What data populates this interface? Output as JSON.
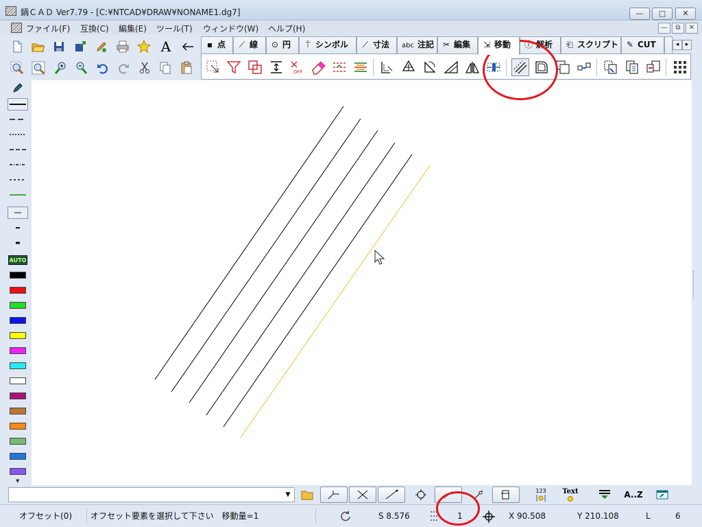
{
  "window": {
    "title": "鍋ＣＡＤ Ver7.79 - [C:¥NTCAD¥DRAW¥NONAME1.dg7]",
    "min_glyph": "—",
    "max_glyph": "□",
    "close_glyph": "✕"
  },
  "menu": {
    "items": [
      "ファイル(F)",
      "互換(C)",
      "編集(E)",
      "ツール(T)",
      "ウィンドウ(W)",
      "ヘルプ(H)"
    ],
    "mdi_buttons": [
      "—",
      "⧉",
      "✕"
    ]
  },
  "toolbar_row1_icons": [
    "new-file-icon",
    "open-folder-icon",
    "save-icon",
    "export-icon",
    "pencil-import-icon",
    "print-icon",
    "star-icon",
    "text-a-icon",
    "arrow-left-icon"
  ],
  "toolbar_row1_glyphs": {
    "text_a": "A",
    "arrow": "⇐"
  },
  "toolbar_row2_icons": [
    "zoom-window-icon",
    "zoom-fit-icon",
    "zoom-in-icon",
    "zoom-out-icon",
    "undo-icon",
    "redo-icon",
    "cut-icon",
    "copy-icon",
    "paste-icon"
  ],
  "tabs": [
    {
      "icon": "▪",
      "label": "点"
    },
    {
      "icon": "⟋",
      "label": "線"
    },
    {
      "icon": "⊙",
      "label": "円"
    },
    {
      "icon": "⍑",
      "label": "シンボル"
    },
    {
      "icon": "⟋",
      "label": "寸法"
    },
    {
      "icon": "abc",
      "label": "注記"
    },
    {
      "icon": "✂",
      "label": "編集"
    },
    {
      "icon": "⇲",
      "label": "移動"
    },
    {
      "icon": "ⓘ",
      "label": "解析"
    },
    {
      "icon": "⎗",
      "label": "スクリプト"
    },
    {
      "icon": "✎",
      "label": "CUT"
    }
  ],
  "active_tab": "移動",
  "tab_scroll": {
    "left": "◂",
    "right": "▸"
  },
  "move_panel_icons": [
    "select-move-icon",
    "filter-icon",
    "rotate-copy-icon",
    "offset-vertical-icon",
    "snap-off-icon",
    "erase-icon",
    "mirror-h-icon",
    "mirror-v-icon",
    "scale-icon",
    "rotate-icon",
    "rotate-cw-icon",
    "shear-icon",
    "mirror-triangle-icon",
    "stretch-icon",
    "offset-icon",
    "outline-offset-icon",
    "copy-shape-icon",
    "array-icon",
    "move-copy-icon",
    "duplicate-icon",
    "transfer-icon",
    "grid-icon"
  ],
  "palette": {
    "line_styles": [
      "pen-icon",
      "solid-line",
      "dashed-line",
      "dotted-line",
      "dash-line-2",
      "dash-dot-line",
      "fine-dot-line",
      "green-line"
    ],
    "widths": [
      "thin",
      "medium",
      "thick"
    ],
    "auto_label": "AUTO",
    "colors": [
      "#000000",
      "#ee1111",
      "#22dd22",
      "#1111ee",
      "#ffff00",
      "#ee22ee",
      "#22eeee",
      "#ffffff",
      "#aa1177",
      "#bb7733",
      "#ff8811",
      "#77bb77",
      "#2277dd",
      "#8855ee"
    ]
  },
  "drawing": {
    "black_lines": 5,
    "offset_line_color": "#f2c236",
    "cursor": "arrow-cursor"
  },
  "bottom_toolbar": {
    "command_value": "",
    "command_arrow": "▼",
    "icons": [
      "folder-icon",
      "snap-endpoint-icon",
      "snap-intersection-icon",
      "snap-line-icon",
      "snap-center-icon",
      "snap-free-icon",
      "snap-point-icon",
      "snap-edit-icon",
      "number-bulb-icon",
      "text-bulb-icon",
      "layer-icon",
      "sort-az-icon",
      "window-icon"
    ],
    "az_label": "A..Z",
    "text_label": "Text",
    "num_label": "123"
  },
  "status": {
    "mode": "オフセット(0)",
    "message": "オフセット要素を選択して下さい　移動量=1",
    "scale": "S 8.576",
    "grid_value": "1",
    "x": "X 90.508",
    "y": "Y 210.108",
    "layer_label": "L",
    "layer_value": "6"
  },
  "annotation_color": "#e4161e"
}
